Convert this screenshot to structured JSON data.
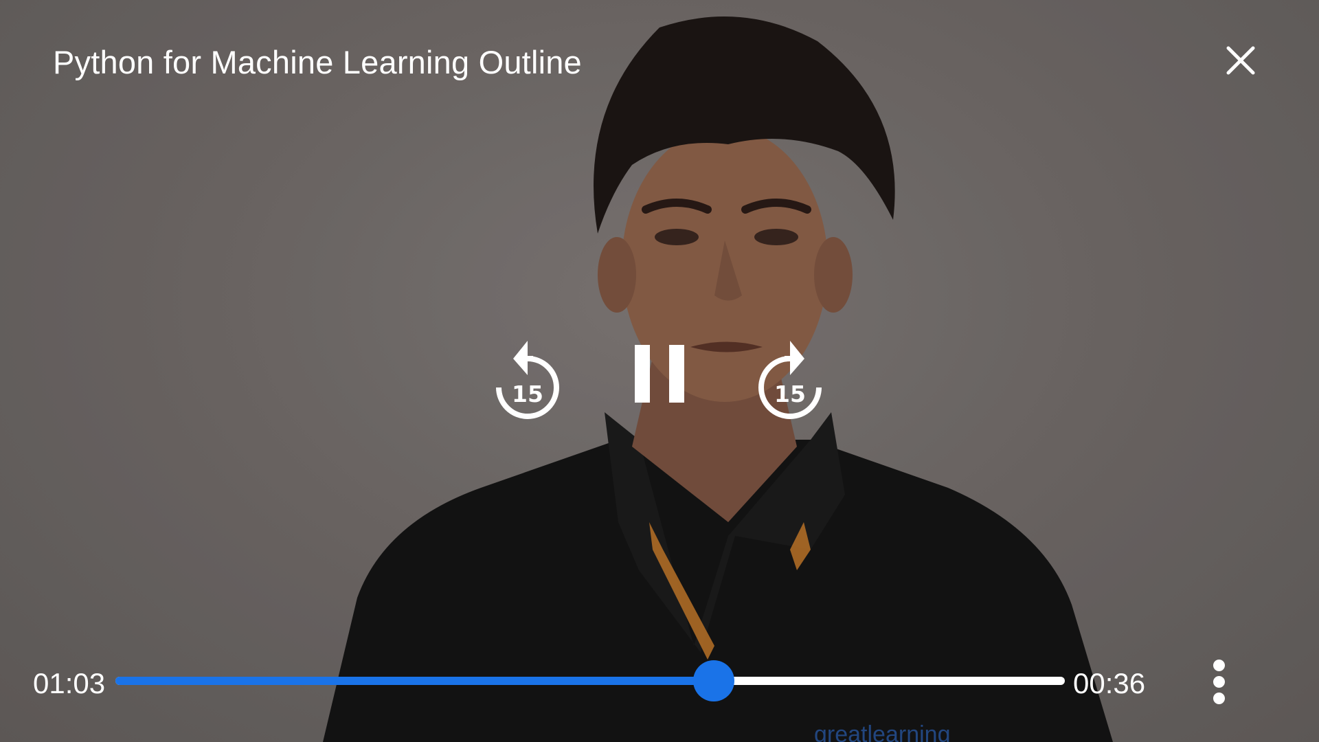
{
  "header": {
    "title": "Python for Machine Learning Outline",
    "close_icon": "close-icon"
  },
  "controls": {
    "rewind_seconds": "15",
    "forward_seconds": "15",
    "rewind_icon": "replay-15-icon",
    "pause_icon": "pause-icon",
    "forward_icon": "forward-15-icon"
  },
  "progress": {
    "elapsed": "01:03",
    "remaining": "00:36",
    "played_fraction": 0.63
  },
  "more_icon": "more-vert-icon",
  "colors": {
    "accent": "#1a73e8",
    "foreground": "#ffffff",
    "background": "#726c6a"
  }
}
